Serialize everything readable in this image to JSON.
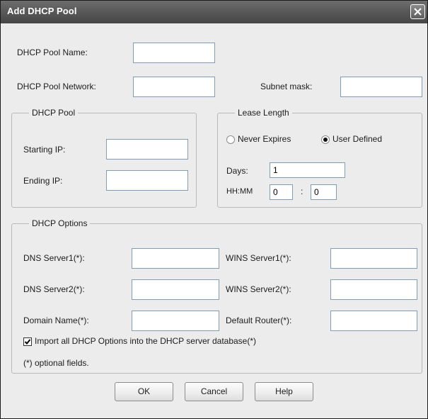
{
  "window": {
    "title": "Add DHCP Pool"
  },
  "pool_name": {
    "label": "DHCP Pool Name:",
    "value": ""
  },
  "pool_network": {
    "label": "DHCP Pool Network:",
    "value": ""
  },
  "subnet_mask": {
    "label": "Subnet mask:",
    "value": ""
  },
  "dhcp_pool_group": {
    "legend": "DHCP Pool",
    "starting_ip": {
      "label": "Starting IP:",
      "value": ""
    },
    "ending_ip": {
      "label": "Ending IP:",
      "value": ""
    }
  },
  "lease_length": {
    "legend": "Lease Length",
    "never_expires": {
      "label": "Never Expires",
      "selected": false
    },
    "user_defined": {
      "label": "User Defined",
      "selected": true
    },
    "days": {
      "label": "Days:",
      "value": "1"
    },
    "hhmm": {
      "label": "HH:MM",
      "hours": "0",
      "separator": ":",
      "minutes": "0"
    }
  },
  "dhcp_options": {
    "legend": "DHCP Options",
    "dns_server1": {
      "label": "DNS Server1(*):",
      "value": ""
    },
    "dns_server2": {
      "label": "DNS Server2(*):",
      "value": ""
    },
    "domain_name": {
      "label": "Domain Name(*):",
      "value": ""
    },
    "wins_server1": {
      "label": "WINS Server1(*):",
      "value": ""
    },
    "wins_server2": {
      "label": "WINS Server2(*):",
      "value": ""
    },
    "default_router": {
      "label": "Default Router(*):",
      "value": ""
    },
    "import_all": {
      "label": "Import all DHCP Options into the DHCP server database(*)",
      "checked": true
    },
    "optional_note": "(*) optional fields."
  },
  "buttons": {
    "ok": "OK",
    "cancel": "Cancel",
    "help": "Help"
  }
}
